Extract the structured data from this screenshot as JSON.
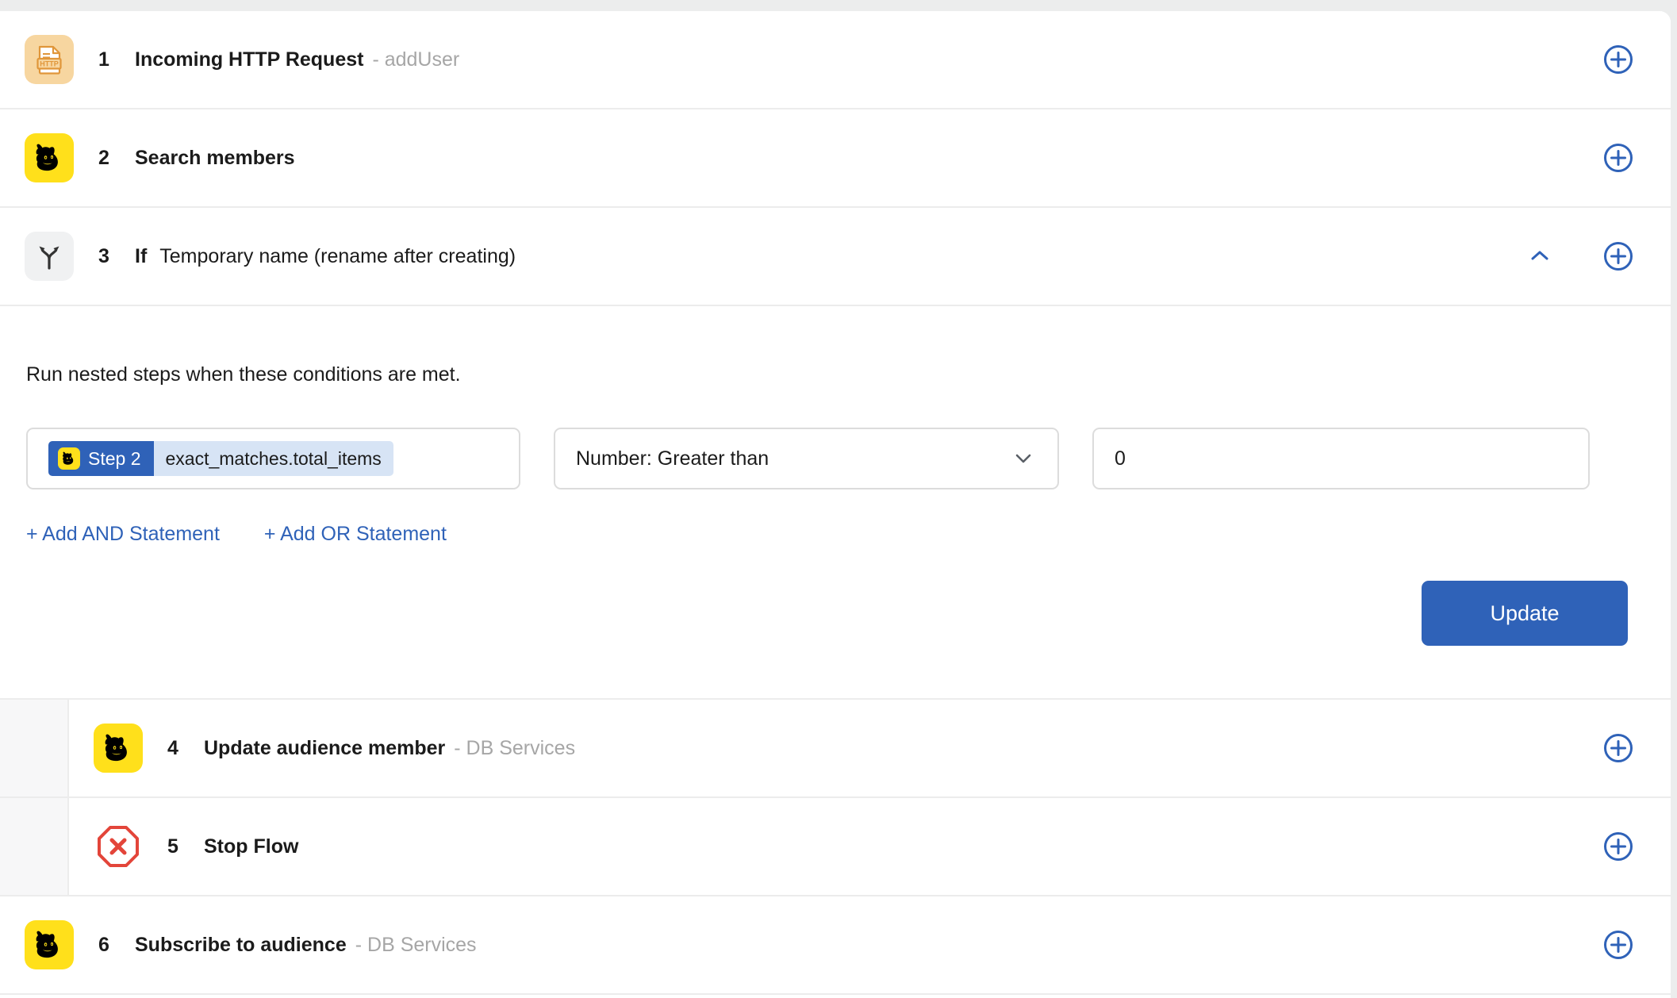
{
  "colors": {
    "accent_blue": "#2f62b8",
    "mailchimp_yellow": "#ffe01b",
    "http_orange": "#f7d6a0",
    "stop_red": "#e3453a",
    "muted_text": "#a6a6a6",
    "token_body_bg": "#d7e4f5",
    "page_bg": "#eceded"
  },
  "steps": [
    {
      "number": "1",
      "title": "Incoming HTTP Request",
      "subtitle": "- addUser",
      "icon": "http-document-icon"
    },
    {
      "number": "2",
      "title": "Search members",
      "subtitle": "",
      "icon": "mailchimp-icon"
    },
    {
      "number": "3",
      "prefix": "If",
      "title": "Temporary name (rename after creating)",
      "subtitle": "",
      "icon": "branch-fork-icon",
      "collapse_icon": "chevron-up-icon"
    }
  ],
  "condition_panel": {
    "description": "Run nested steps when these conditions are met.",
    "condition": {
      "token": {
        "step_label": "Step 2",
        "field_path": "exact_matches.total_items",
        "icon": "mailchimp-icon"
      },
      "operator": "Number: Greater than",
      "operator_icon": "chevron-down-icon",
      "value": "0"
    },
    "add_and_label": "+ Add AND Statement",
    "add_or_label": "+ Add OR Statement",
    "update_label": "Update"
  },
  "nested_steps": [
    {
      "number": "4",
      "title": "Update audience member",
      "subtitle": "- DB Services",
      "icon": "mailchimp-icon"
    },
    {
      "number": "5",
      "title": "Stop Flow",
      "subtitle": "",
      "icon": "stop-flow-icon"
    }
  ],
  "trailing_steps": [
    {
      "number": "6",
      "title": "Subscribe to audience",
      "subtitle": "- DB Services",
      "icon": "mailchimp-icon"
    }
  ],
  "add_step_icon": "circle-plus-icon"
}
